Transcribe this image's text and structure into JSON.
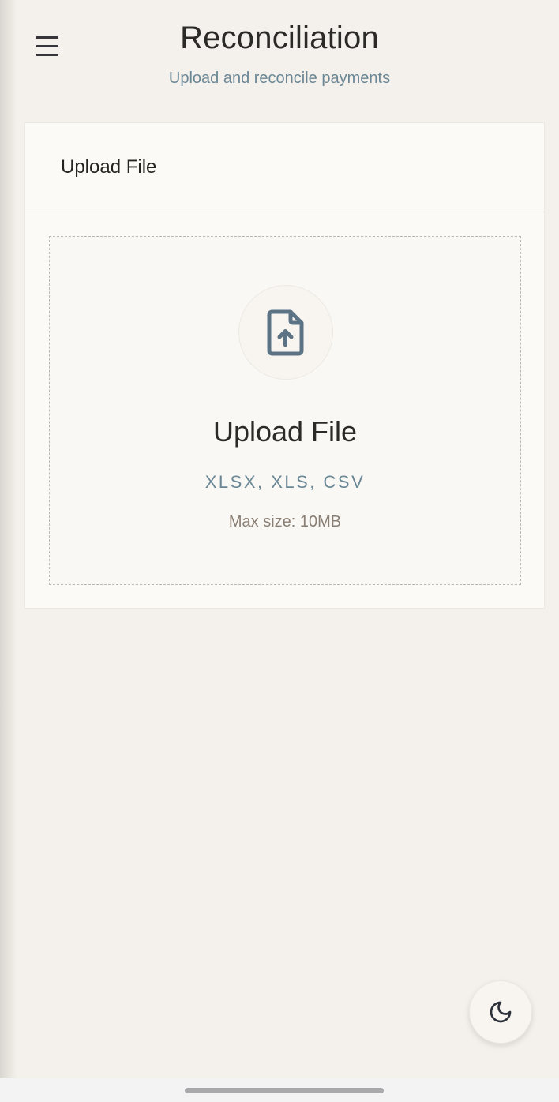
{
  "header": {
    "title": "Reconciliation",
    "subtitle": "Upload and reconcile payments",
    "menu_icon": "hamburger-menu-icon"
  },
  "card": {
    "title": "Upload File"
  },
  "dropzone": {
    "icon": "file-upload-icon",
    "title": "Upload File",
    "formats": "XLSX, XLS, CSV",
    "max_size": "Max size: 10MB"
  },
  "theme_toggle": {
    "icon": "moon-icon"
  },
  "colors": {
    "background": "#f4f1ec",
    "card": "#fcfaf7",
    "accent_slate": "#6a8796",
    "icon_slate": "#5b7384",
    "text_dark": "#2c2a27",
    "text_muted": "#8a7f74"
  }
}
